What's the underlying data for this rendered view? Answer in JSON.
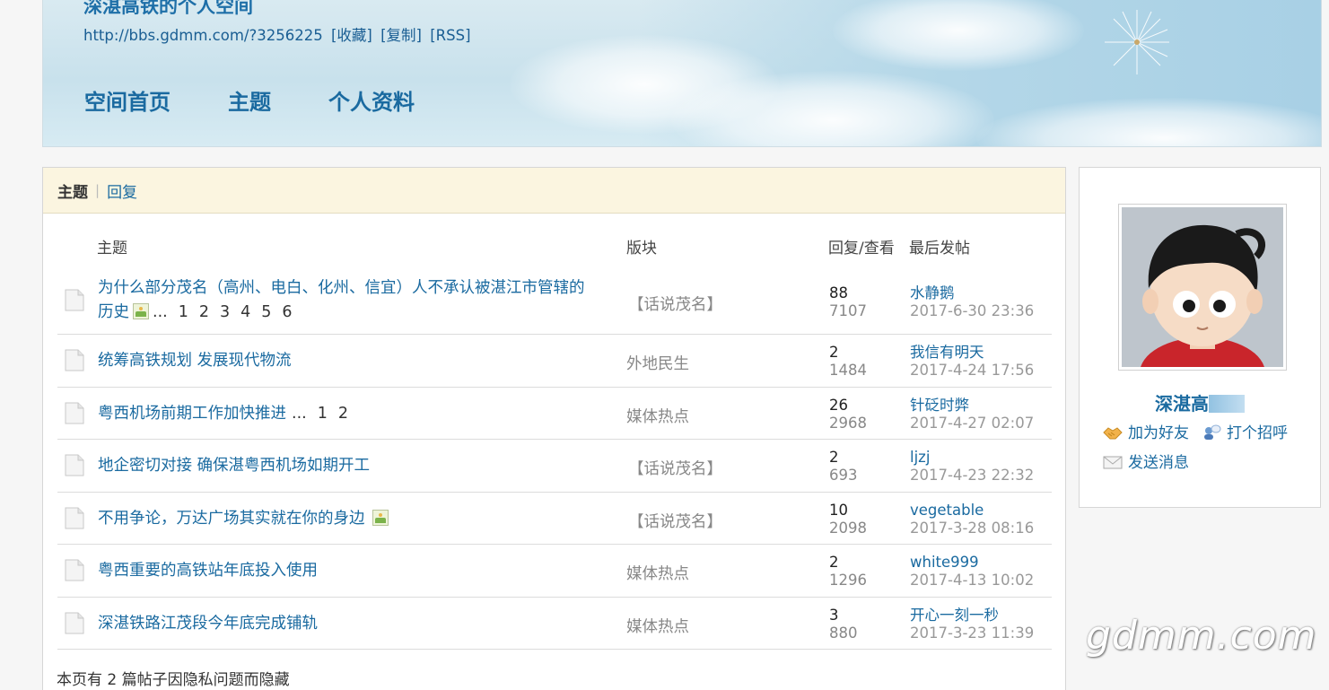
{
  "header": {
    "title": "深湛高铁的个人空间",
    "url": "http://bbs.gdmm.com/?3256225",
    "links": [
      "[收藏]",
      "[复制]",
      "[RSS]"
    ],
    "nav": [
      "空间首页",
      "主题",
      "个人资料"
    ]
  },
  "tabs": {
    "active": "主题",
    "separator": "|",
    "other": "回复"
  },
  "table": {
    "columns": {
      "subject": "主题",
      "forum": "版块",
      "stats": "回复/查看",
      "last": "最后发帖"
    },
    "rows": [
      {
        "subject_line1": "为什么部分茂名（高州、电白、化州、信宜）人不承认被湛江市管辖的",
        "subject_line2": "历史",
        "has_pic": true,
        "pages_prefix": "...",
        "pages": [
          "1",
          "2",
          "3",
          "4",
          "5",
          "6"
        ],
        "forum": "【话说茂名】",
        "replies": "88",
        "views": "7107",
        "last_user": "水静鹅",
        "last_time": "2017-6-30 23:36"
      },
      {
        "subject_line1": "统筹高铁规划 发展现代物流",
        "forum": "外地民生",
        "replies": "2",
        "views": "1484",
        "last_user": "我信有明天",
        "last_time": "2017-4-24 17:56"
      },
      {
        "subject_line1": "粤西机场前期工作加快推进",
        "pages_prefix": "...",
        "pages": [
          "1",
          "2"
        ],
        "forum": "媒体热点",
        "replies": "26",
        "views": "2968",
        "last_user": "针砭时弊",
        "last_time": "2017-4-27 02:07"
      },
      {
        "subject_line1": "地企密切对接 确保湛粤西机场如期开工",
        "forum": "【话说茂名】",
        "replies": "2",
        "views": "693",
        "last_user": "ljzj",
        "last_time": "2017-4-23 22:32"
      },
      {
        "subject_line1": "不用争论，万达广场其实就在你的身边",
        "has_pic": true,
        "forum": "【话说茂名】",
        "replies": "10",
        "views": "2098",
        "last_user": "vegetable",
        "last_time": "2017-3-28 08:16"
      },
      {
        "subject_line1": "粤西重要的高铁站年底投入使用",
        "forum": "媒体热点",
        "replies": "2",
        "views": "1296",
        "last_user": "white999",
        "last_time": "2017-4-13 10:02"
      },
      {
        "subject_line1": "深湛铁路江茂段今年底完成铺轨",
        "forum": "媒体热点",
        "replies": "3",
        "views": "880",
        "last_user": "开心一刻一秒",
        "last_time": "2017-3-23 11:39"
      }
    ],
    "hidden_note": "本页有 2 篇帖子因隐私问题而隐藏"
  },
  "profile": {
    "name": "深湛高",
    "add_friend": "加为好友",
    "greet": "打个招呼",
    "message": "发送消息"
  },
  "watermark": "gdmm.com",
  "colors": {
    "link": "#1a6aa0",
    "tab_bg": "#fbf5e0",
    "muted": "#888888"
  }
}
